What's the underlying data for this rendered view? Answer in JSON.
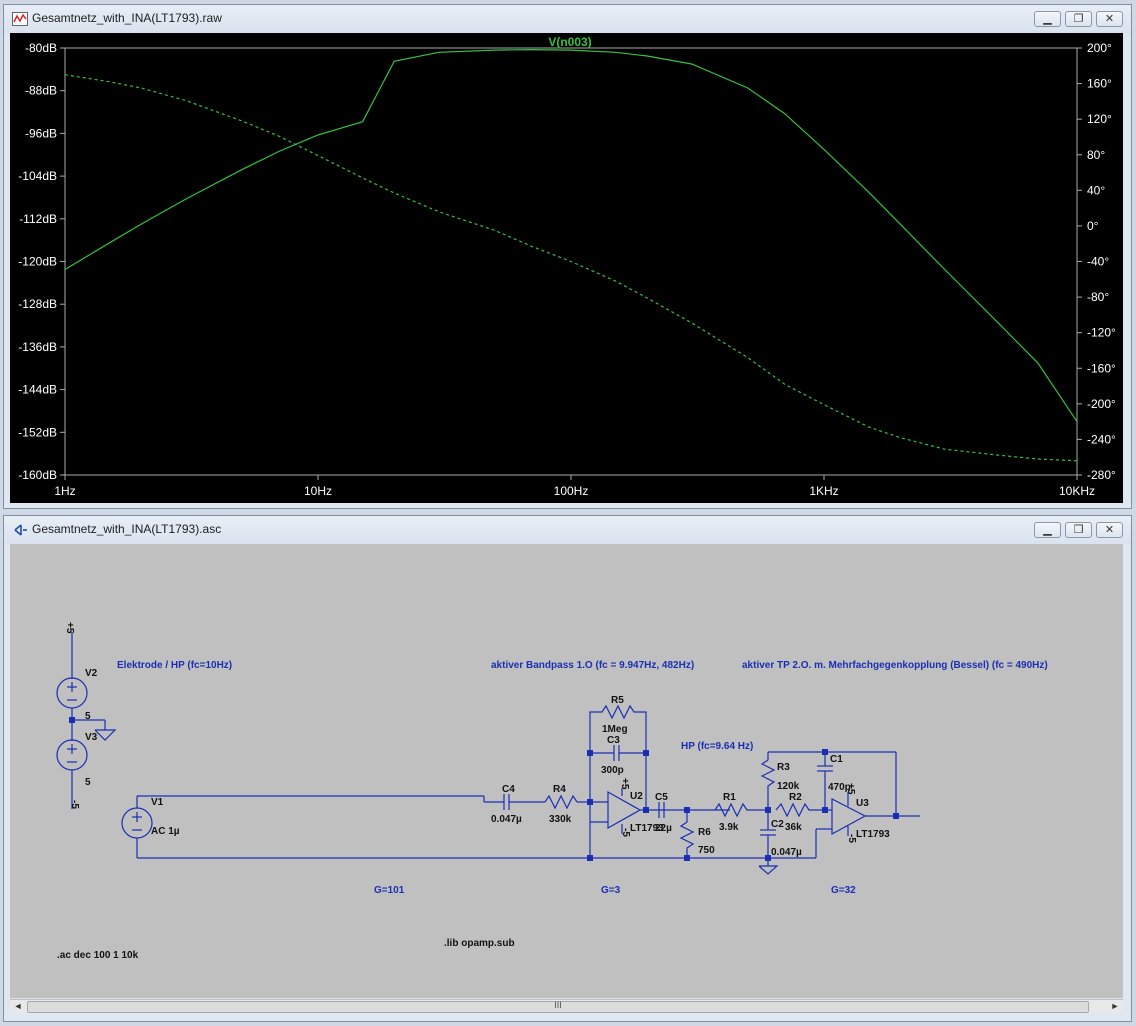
{
  "plot_window": {
    "title": "Gesamtnetz_with_INA(LT1793).raw",
    "trace_label": "V(n003)",
    "minimize_icon": "minimize-icon",
    "restore_icon": "restore-icon",
    "close_icon": "close-icon"
  },
  "chart_data": {
    "type": "line",
    "x_scale": "log",
    "xlim": [
      1,
      10000
    ],
    "x_tick_labels": [
      "1Hz",
      "10Hz",
      "100Hz",
      "1KHz",
      "10KHz"
    ],
    "left_axis": {
      "ylim": [
        -160,
        -80
      ],
      "unit": "dB",
      "tick_labels": [
        "-80dB",
        "-88dB",
        "-96dB",
        "-104dB",
        "-112dB",
        "-120dB",
        "-128dB",
        "-136dB",
        "-144dB",
        "-152dB",
        "-160dB"
      ]
    },
    "right_axis": {
      "ylim": [
        -280,
        200
      ],
      "unit": "°",
      "tick_labels": [
        "200°",
        "160°",
        "120°",
        "80°",
        "40°",
        "0°",
        "-40°",
        "-80°",
        "-120°",
        "-160°",
        "-200°",
        "-240°",
        "-280°"
      ]
    },
    "grid": false,
    "series": [
      {
        "name": "V(n003)",
        "axis": "left",
        "style": "solid",
        "color": "#35c13d",
        "x": [
          1,
          1.5,
          2,
          3,
          5,
          7,
          10,
          15,
          20,
          30,
          50,
          70,
          100,
          150,
          200,
          300,
          500,
          700,
          1000,
          1500,
          2000,
          3000,
          5000,
          7000,
          10000
        ],
        "y": [
          -121.5,
          -116.5,
          -113,
          -108.3,
          -102.8,
          -99.4,
          -96.3,
          -93.8,
          -82.5,
          -80.8,
          -80.4,
          -80.3,
          -80.4,
          -80.8,
          -81.5,
          -83,
          -87.5,
          -92.3,
          -99,
          -107,
          -113,
          -121.5,
          -132,
          -139,
          -150
        ]
      },
      {
        "name": "V(n003) phase",
        "axis": "right",
        "style": "dashed",
        "color": "#35c13d",
        "x": [
          1,
          1.5,
          2,
          3,
          5,
          7,
          10,
          15,
          20,
          30,
          50,
          70,
          100,
          150,
          200,
          300,
          500,
          700,
          1000,
          1500,
          2000,
          3000,
          5000,
          7000,
          10000
        ],
        "y": [
          170,
          162,
          155,
          141,
          118,
          101,
          79,
          54,
          37,
          16,
          -5,
          -23,
          -40,
          -62,
          -81,
          -109,
          -148,
          -178,
          -201,
          -226,
          -238,
          -251,
          -258,
          -262,
          -264
        ]
      }
    ]
  },
  "schematic_window": {
    "title": "Gesamtnetz_with_INA(LT1793).asc",
    "minimize_icon": "minimize-icon",
    "restore_icon": "restore-icon",
    "close_icon": "close-icon",
    "scroll_grip": "III",
    "scroll_left": "◄",
    "scroll_right": "►"
  },
  "schematic": {
    "comments": {
      "electrode": "Elektrode / HP (fc=10Hz)",
      "bandpass": "aktiver Bandpass 1.O (fc = 9.947Hz, 482Hz)",
      "lowpass": "aktiver TP 2.O. m. Mehrfachgegenkopplung (Bessel) (fc = 490Hz)",
      "highpass": "HP (fc=9.64 Hz)",
      "gain1": "G=101",
      "gain2": "G=3",
      "gain3": "G=32",
      "lib": ".lib opamp.sub",
      "ac": ".ac dec 100 1 10k"
    },
    "components": {
      "V1": {
        "name": "V1",
        "value": "AC 1µ"
      },
      "V2": {
        "name": "V2",
        "value": "5"
      },
      "V3": {
        "name": "V3",
        "value": "5"
      },
      "C4": {
        "name": "C4",
        "value": "0.047µ"
      },
      "R4": {
        "name": "R4",
        "value": "330k"
      },
      "R5": {
        "name": "R5",
        "value": "1Meg"
      },
      "C3": {
        "name": "C3",
        "value": "300p"
      },
      "U2": {
        "name": "U2",
        "value": "LT1793"
      },
      "C5": {
        "name": "C5",
        "value": "22µ"
      },
      "R6": {
        "name": "R6",
        "value": "750"
      },
      "R1": {
        "name": "R1",
        "value": "3.9k"
      },
      "R3": {
        "name": "R3",
        "value": "120k"
      },
      "C2": {
        "name": "C2",
        "value": "0.047µ"
      },
      "R2": {
        "name": "R2",
        "value": "36k"
      },
      "C1": {
        "name": "C1",
        "value": "470p"
      },
      "U3": {
        "name": "U3",
        "value": "LT1793"
      }
    },
    "supply_labels": {
      "pos": "+5",
      "neg": "-5"
    }
  }
}
